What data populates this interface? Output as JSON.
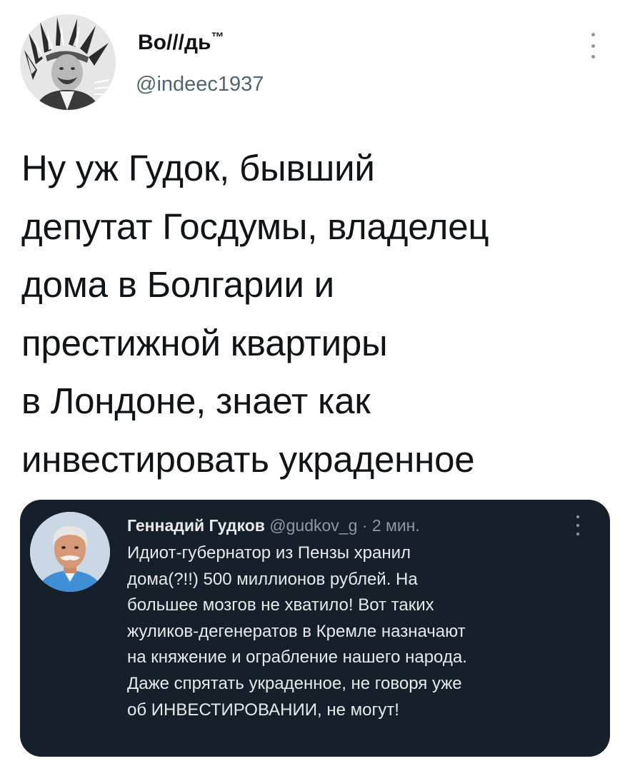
{
  "tweet": {
    "author": {
      "name": "Bo///дь",
      "trademark": "™",
      "handle": "@indeec1937",
      "avatar_icon": "chief-headdress-avatar"
    },
    "more_icon": "more-vertical-icon",
    "text_lines": [
      "Ну уж Гудок, бывший",
      "депутат Госдумы, владелец",
      "дома в Болгарии и",
      "престижной квартиры",
      "в Лондоне, знает как",
      "инвестировать украденное"
    ]
  },
  "quoted_tweet": {
    "author": {
      "name": "Геннадий Гудков",
      "handle": "@gudkov_g",
      "separator": "·",
      "time": "2 мин.",
      "avatar_icon": "gray-haired-man-avatar"
    },
    "more_icon": "more-vertical-icon",
    "text_lines": [
      "Идиот-губернатор из Пензы хранил",
      "дома(?!!) 500 миллионов рублей. На",
      "большее мозгов не хватило! Вот таких",
      "жуликов-дегенератов в Кремле назначают",
      "на княжение и ограбление нашего народа.",
      "Даже спрятать украденное, не говоря уже",
      "об ИНВЕСТИРОВАНИИ, не могут!"
    ],
    "colors": {
      "background": "#15202b",
      "text": "#e7e9ea",
      "secondary": "#8b98a5"
    }
  }
}
